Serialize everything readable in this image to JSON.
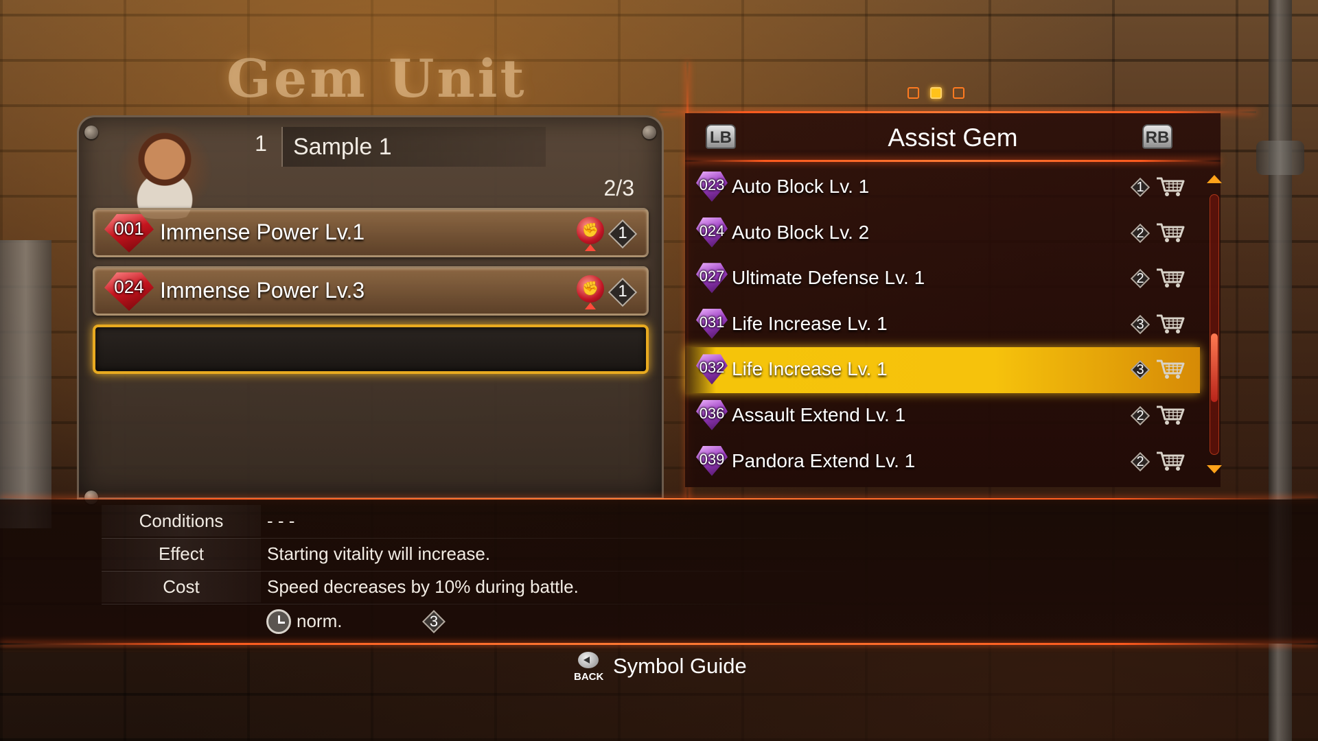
{
  "screen_title": "Gem Unit",
  "unit": {
    "slot_number": "1",
    "name": "Sample 1",
    "capacity": "2/3",
    "equipped": [
      {
        "id": "001",
        "name": "Immense Power Lv.1",
        "type_icon": "fist-icon",
        "cost": "1"
      },
      {
        "id": "024",
        "name": "Immense Power Lv.3",
        "type_icon": "fist-icon",
        "cost": "1"
      }
    ]
  },
  "pages": {
    "count": 3,
    "active_index": 1
  },
  "gem_list": {
    "left_bumper": "LB",
    "right_bumper": "RB",
    "category": "Assist Gem",
    "items": [
      {
        "id": "023",
        "name": "Auto Block Lv. 1",
        "cost": "1"
      },
      {
        "id": "024",
        "name": "Auto Block Lv. 2",
        "cost": "2"
      },
      {
        "id": "027",
        "name": "Ultimate Defense Lv. 1",
        "cost": "2"
      },
      {
        "id": "031",
        "name": "Life Increase Lv. 1",
        "cost": "3"
      },
      {
        "id": "032",
        "name": "Life Increase Lv. 1",
        "cost": "3"
      },
      {
        "id": "036",
        "name": "Assault Extend Lv. 1",
        "cost": "2"
      },
      {
        "id": "039",
        "name": "Pandora Extend Lv. 1",
        "cost": "2"
      }
    ],
    "selected_index": 4,
    "scroll_position": 0.72
  },
  "details": {
    "conditions_label": "Conditions",
    "conditions_value": "- - -",
    "effect_label": "Effect",
    "effect_value": "Starting vitality will increase.",
    "cost_label": "Cost",
    "cost_value": "Speed decreases by 10% during battle.",
    "speed": "norm.",
    "gem_cost": "3"
  },
  "footer": {
    "back_label": "BACK",
    "guide_label": "Symbol Guide"
  },
  "colors": {
    "accent_orange": "#ff5a1e",
    "highlight_yellow": "#f5c40a",
    "selected_border": "#e8aa20",
    "assist_gem": "#9a3cc0",
    "power_gem": "#c4141e"
  }
}
